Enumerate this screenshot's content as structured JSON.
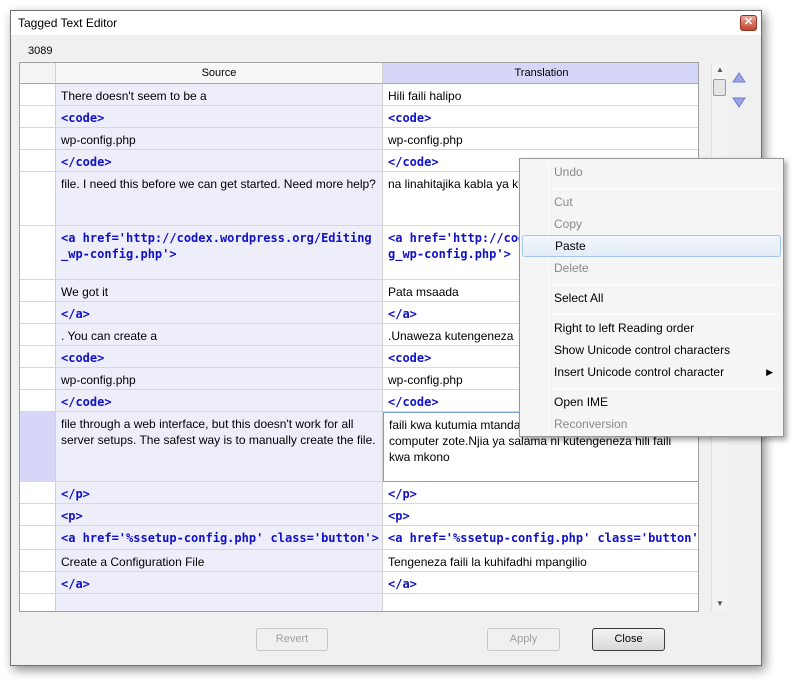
{
  "window": {
    "title": "Tagged Text Editor",
    "close_glyph": "✕"
  },
  "counter": "3089",
  "columns": {
    "source": "Source",
    "translation": "Translation"
  },
  "rows": [
    {
      "source": "There doesn't seem to be a",
      "translation": "Hili faili halipo",
      "tag": false
    },
    {
      "source": "<code>",
      "translation": "<code>",
      "tag": true
    },
    {
      "source": "wp-config.php",
      "translation": "wp-config.php",
      "tag": false
    },
    {
      "source": "</code>",
      "translation": "</code>",
      "tag": true
    },
    {
      "source": " file. I need this before we can get started. Need more help?",
      "translation": " na linahitajika kabla ya kuanza. Unahitaji msaada zaidi?",
      "tag": false
    },
    {
      "source": "<a href='http://codex.wordpress.org/Editing_wp-config.php'>",
      "translation": "<a href='http://codex.wordpress.org/Editing_wp-config.php'>",
      "tag": true
    },
    {
      "source": "We got it",
      "translation": "Pata msaada",
      "tag": false
    },
    {
      "source": "</a>",
      "translation": "</a>",
      "tag": true
    },
    {
      "source": ". You can create a",
      "translation": ".Unaweza kutengeneza",
      "tag": false
    },
    {
      "source": "<code>",
      "translation": "<code>",
      "tag": true
    },
    {
      "source": "wp-config.php",
      "translation": "wp-config.php",
      "tag": false
    },
    {
      "source": "</code>",
      "translation": "</code>",
      "tag": true
    },
    {
      "source": " file through a web interface, but this doesn't work for all server setups. The safest way is to manually create the file.",
      "translation": " faili kwa kutumia mtandao, lakini haifanyi kazi kwa computer zote.Njia ya salama ni kutengeneza hili faili kwa mkono",
      "tag": false
    },
    {
      "source": "</p>",
      "translation": "</p>",
      "tag": true
    },
    {
      "source": "<p>",
      "translation": "<p>",
      "tag": true
    },
    {
      "source": "<a href='%ssetup-config.php' class='button'>",
      "translation": "<a href='%ssetup-config.php' class='button'>",
      "tag": true
    },
    {
      "source": "Create a Configuration File",
      "translation": "Tengeneza faili la kuhifadhi mpangilio",
      "tag": false
    },
    {
      "source": "</a>",
      "translation": "</a>",
      "tag": true
    }
  ],
  "buttons": {
    "revert": "Revert",
    "apply": "Apply",
    "close": "Close"
  },
  "context_menu": {
    "undo": "Undo",
    "cut": "Cut",
    "copy": "Copy",
    "paste": "Paste",
    "delete": "Delete",
    "select_all": "Select All",
    "rtl": "Right to left Reading order",
    "show_unicode": "Show Unicode control characters",
    "insert_unicode": "Insert Unicode control character",
    "open_ime": "Open IME",
    "reconversion": "Reconversion"
  },
  "colors": {
    "tag": "#1010c8",
    "selected_row": "#d6d6f8",
    "source_bg": "#eeeefb"
  }
}
